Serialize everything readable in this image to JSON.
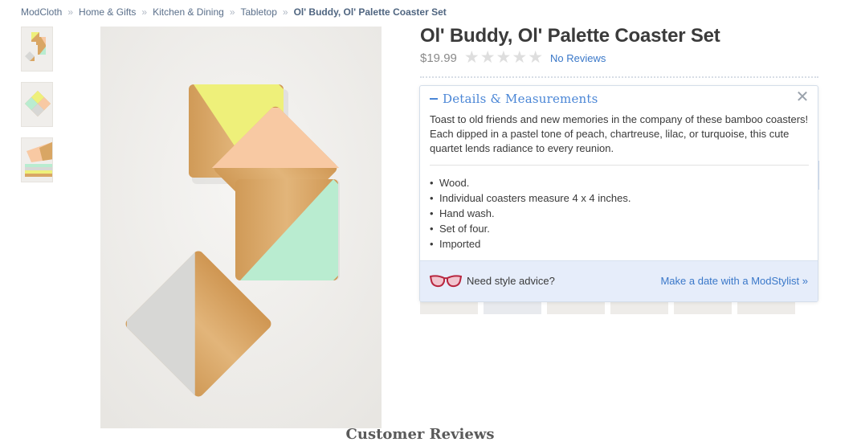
{
  "breadcrumb": {
    "items": [
      "ModCloth",
      "Home & Gifts",
      "Kitchen & Dining",
      "Tabletop"
    ],
    "current": "Ol' Buddy, Ol' Palette Coaster Set",
    "separator": "»"
  },
  "product": {
    "title": "Ol' Buddy, Ol' Palette Coaster Set",
    "price": "$19.99",
    "rating": 0,
    "rating_max": 5,
    "reviews_link": "No Reviews"
  },
  "details": {
    "heading": "Details & Measurements",
    "description": "Toast to old friends and new memories in the company of these bamboo coasters! Each dipped in a pastel tone of peach, chartreuse, lilac, or turquoise, this cute quartet lends radiance to every reunion.",
    "features": [
      "Wood.",
      "Individual coasters measure 4 x 4 inches.",
      "Hand wash.",
      "Set of four.",
      "Imported"
    ],
    "close_icon": "close-icon"
  },
  "advice": {
    "text": "Need style advice?",
    "link": "Make a date with a ModStylist »",
    "icon": "glasses-icon"
  },
  "reviews_section": {
    "heading": "Customer Reviews"
  },
  "colors": {
    "link": "#3a78c9",
    "panel_heading": "#4a86d6",
    "advice_bg": "#e6edfa",
    "chartreuse": "#eef07a",
    "peach": "#f8c9a3",
    "mint": "#b9ecd0",
    "grey": "#d7d7d5",
    "bamboo": "#d9a664"
  }
}
